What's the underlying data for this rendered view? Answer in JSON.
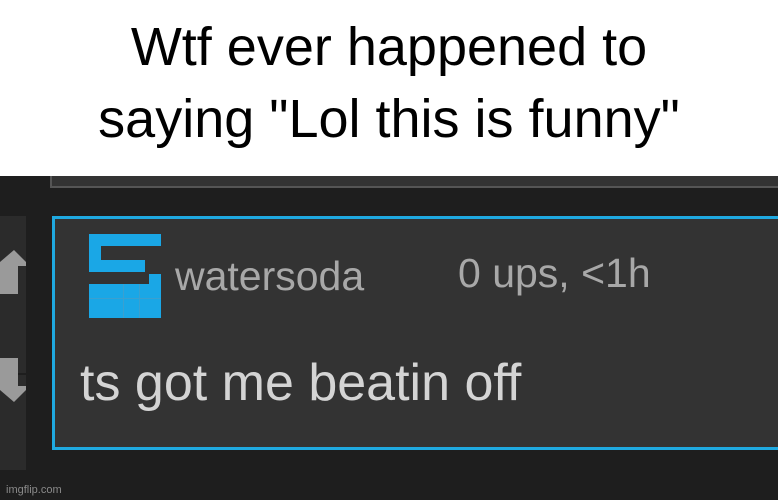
{
  "caption": {
    "line1": "Wtf ever happened to",
    "line2": "saying \"Lol this is funny\""
  },
  "comment": {
    "username": "watersoda",
    "meta": "0 ups, <1h",
    "text": "ts got me beatin off",
    "avatar_icon": "imgflip-user-avatar-icon",
    "accent_color": "#1fa9e0"
  },
  "vote": {
    "up_icon": "upvote-arrow-icon",
    "down_icon": "downvote-arrow-icon"
  },
  "watermark": "imgflip.com"
}
